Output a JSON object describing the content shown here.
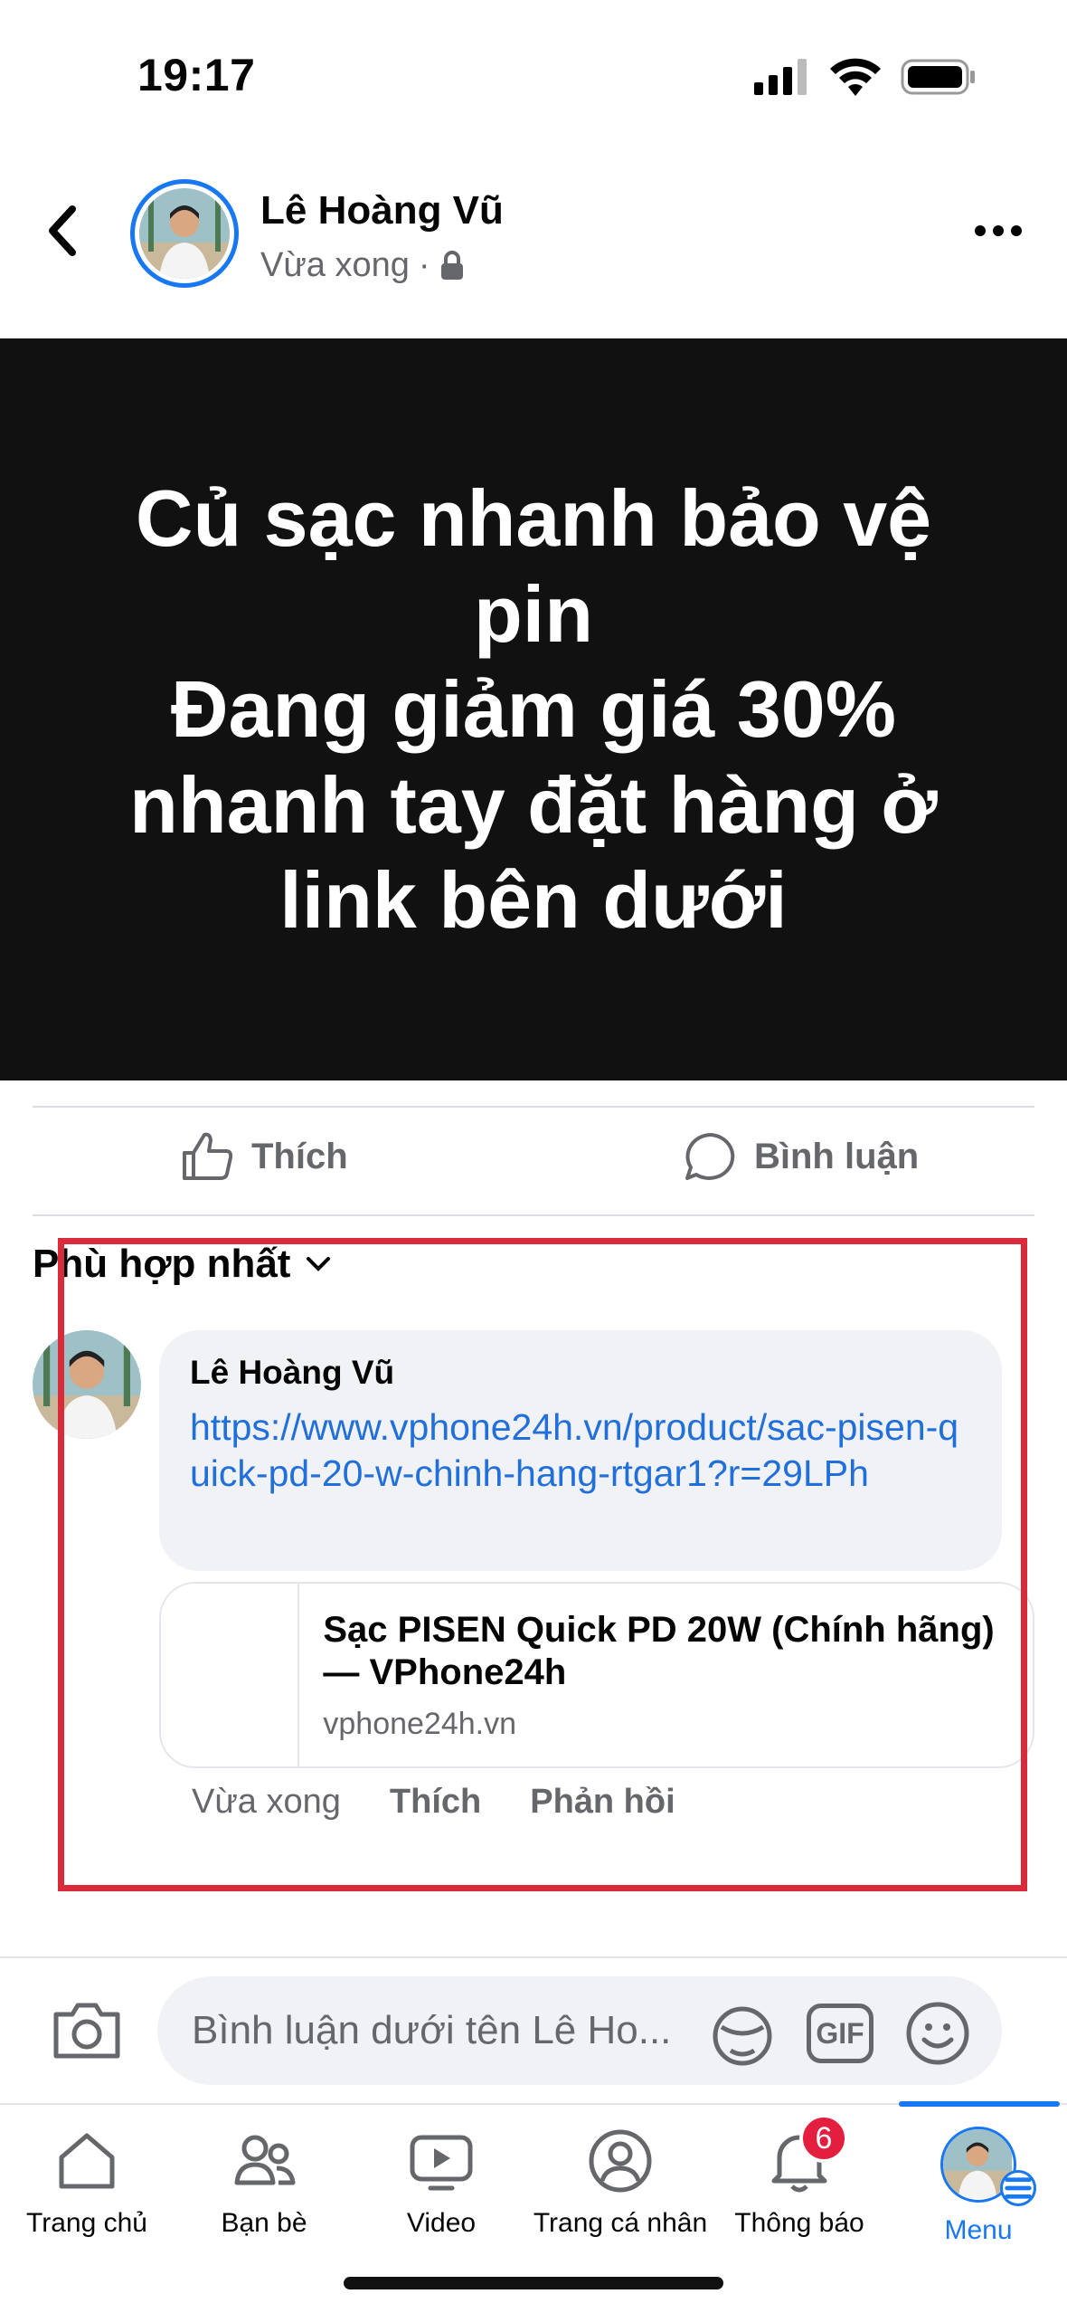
{
  "status_bar": {
    "time": "19:17",
    "icons": [
      "signal-icon",
      "wifi-icon",
      "battery-icon"
    ]
  },
  "header": {
    "author": "Lê Hoàng Vũ",
    "time": "Vừa xong",
    "separator": "·",
    "privacy_icon": "lock-icon",
    "back_icon": "chevron-left-icon",
    "more_icon": "more-icon"
  },
  "post": {
    "text": "Củ sạc nhanh bảo vệ pin\nĐang giảm giá 30% nhanh tay đặt hàng ở link bên dưới",
    "background": "#111111"
  },
  "actions": {
    "like_label": "Thích",
    "comment_label": "Bình luận"
  },
  "sort": {
    "label": "Phù hợp nhất"
  },
  "comment": {
    "author": "Lê Hoàng Vũ",
    "link": "https://www.vphone24h.vn/product/sac-pisen-quick-pd-20-w-chinh-hang-rtgar1?r=29LPh",
    "preview_title": "Sạc PISEN Quick PD 20W (Chính hãng) — VPhone24h",
    "preview_domain": "vphone24h.vn",
    "time": "Vừa xong",
    "like_label": "Thích",
    "reply_label": "Phản hồi"
  },
  "composer": {
    "placeholder": "Bình luận dưới tên Lê Ho...",
    "gif_label": "GIF"
  },
  "tabbar": {
    "tabs": [
      {
        "label": "Trang chủ",
        "icon": "home-icon"
      },
      {
        "label": "Bạn bè",
        "icon": "friends-icon"
      },
      {
        "label": "Video",
        "icon": "video-icon"
      },
      {
        "label": "Trang cá nhân",
        "icon": "profile-icon"
      },
      {
        "label": "Thông báo",
        "icon": "bell-icon",
        "badge": "6"
      },
      {
        "label": "Menu",
        "icon": "menu-avatar",
        "active": true
      }
    ]
  },
  "colors": {
    "accent": "#1877f2",
    "highlight": "#d92b3a",
    "link": "#216fdb",
    "badge": "#e41e3f"
  }
}
